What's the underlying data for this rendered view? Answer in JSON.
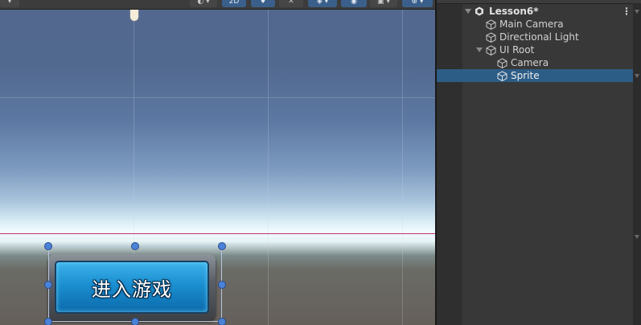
{
  "scene_view": {
    "toolbar": {
      "btn_2d_label": "2D"
    },
    "ui_button": {
      "label": "进入游戏"
    }
  },
  "hierarchy": {
    "scene_name": "Lesson6*",
    "items": [
      {
        "label": "Main Camera",
        "icon": "cube-icon"
      },
      {
        "label": "Directional Light",
        "icon": "cube-icon"
      },
      {
        "label": "UI Root",
        "icon": "cube-icon"
      },
      {
        "label": "Camera",
        "icon": "cube-icon"
      },
      {
        "label": "Sprite",
        "icon": "cube-icon",
        "selected": true
      }
    ],
    "colors": {
      "selection": "#2c5d87",
      "panel_bg": "#383838"
    }
  },
  "colors": {
    "horizon_line": "#c0307a",
    "handle_blue": "#4a82d8"
  }
}
